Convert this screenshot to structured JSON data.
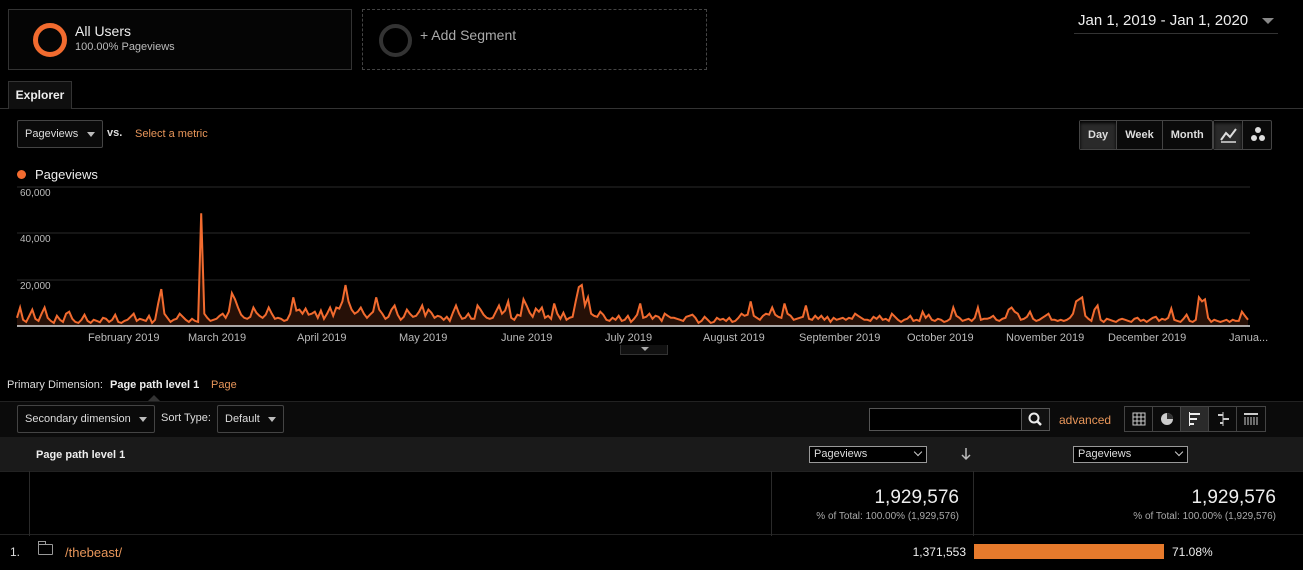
{
  "segments": {
    "active": {
      "title": "All Users",
      "subtitle": "100.00% Pageviews"
    },
    "add_label": "+ Add Segment"
  },
  "date_range": "Jan 1, 2019 - Jan 1, 2020",
  "tabs": {
    "explorer": "Explorer"
  },
  "controls": {
    "metric_select": "Pageviews",
    "vs": "vs.",
    "select_metric": "Select a metric",
    "granularity": [
      "Day",
      "Week",
      "Month"
    ],
    "granularity_selected": "Day"
  },
  "chart_data": {
    "type": "line",
    "series": [
      {
        "name": "Pageviews",
        "color": "#f26b2f",
        "values": [
          4000,
          9000,
          3000,
          2000,
          5000,
          8000,
          3500,
          2500,
          6000,
          9000,
          4000,
          2500,
          1500,
          5000,
          3000,
          2000,
          6000,
          7000,
          3500,
          2000,
          1500,
          3000,
          5500,
          2500,
          1500,
          3000,
          2500,
          1800,
          4000,
          3500,
          2000,
          3000,
          5500,
          2000,
          1500,
          2500,
          3000,
          4500,
          6000,
          2500,
          3500,
          3000,
          2500,
          5000,
          1500,
          3000,
          11000,
          18000,
          6000,
          4000,
          2000,
          3000,
          3500,
          6000,
          4500,
          3000,
          2000,
          3500,
          2500,
          2000,
          55000,
          6000,
          4000,
          2500,
          3000,
          3500,
          5000,
          6000,
          4000,
          7000,
          16000,
          13000,
          9000,
          5500,
          4000,
          3500,
          4500,
          9000,
          6500,
          5000,
          4000,
          5500,
          9000,
          6000,
          3500,
          4000,
          3500,
          2500,
          3000,
          6000,
          14000,
          7500,
          8000,
          6000,
          8500,
          5500,
          6000,
          7000,
          4000,
          7500,
          3500,
          6000,
          9000,
          5000,
          9000,
          8500,
          12000,
          20000,
          12000,
          8000,
          6000,
          7000,
          9000,
          6000,
          4000,
          5500,
          7000,
          14000,
          8000,
          6000,
          3500,
          4500,
          8000,
          10000,
          5500,
          3000,
          4500,
          8000,
          6000,
          4500,
          5000,
          7000,
          10000,
          5000,
          8000,
          6500,
          4000,
          5000,
          4500,
          3000,
          4500,
          2500,
          6500,
          10000,
          6000,
          3500,
          4000,
          6000,
          3500,
          3500,
          10000,
          8000,
          5500,
          4000,
          3500,
          4000,
          7000,
          10000,
          6000,
          7500,
          12000,
          4000,
          3000,
          5500,
          5000,
          13000,
          10000,
          6500,
          4500,
          8500,
          7000,
          9000,
          4000,
          5000,
          3500,
          11000,
          6000,
          3500,
          6500,
          3000,
          4000,
          4500,
          12000,
          19000,
          20000,
          10000,
          14000,
          6000,
          5000,
          4500,
          7000,
          5500,
          3000,
          2500,
          4000,
          3000,
          5000,
          2500,
          3000,
          5000,
          2000,
          3500,
          5500,
          11000,
          4000,
          4500,
          6000,
          3500,
          5000,
          4500,
          2500,
          6000,
          5000,
          4000,
          4000,
          3500,
          3000,
          2500,
          4500,
          5000,
          5500,
          4000,
          1500,
          2500,
          4500,
          3000,
          1500,
          2000,
          4000,
          3000,
          3500,
          2500,
          4000,
          2000,
          2500,
          4000,
          6000,
          5000,
          5500,
          12000,
          5000,
          4000,
          3000,
          5000,
          6000,
          5500,
          9000,
          5500,
          4500,
          4000,
          11000,
          6000,
          5000,
          3000,
          3500,
          4000,
          4500,
          10000,
          3500,
          3000,
          5000,
          3500,
          5000,
          3000,
          4500,
          2000,
          4000,
          3000,
          3500,
          4000,
          3000,
          4000,
          3500,
          6000,
          5000,
          4000,
          3000,
          3000,
          2500,
          4500,
          3500,
          5000,
          3000,
          3500,
          2500,
          6000,
          4500,
          3000,
          2000,
          3000,
          3500,
          5000,
          2500,
          3000,
          2500,
          7000,
          4000,
          5500,
          3000,
          2500,
          3500,
          3000,
          2000,
          2500,
          3500,
          9000,
          5000,
          4000,
          2500,
          3000,
          3500,
          2500,
          4000,
          9000,
          3000,
          3500,
          3500,
          4000,
          5000,
          3000,
          2500,
          3500,
          4000,
          8000,
          9000,
          7000,
          6000,
          3000,
          3500,
          4500,
          7000,
          3500,
          2500,
          3000,
          4000,
          5000,
          6000,
          3000,
          3000,
          2500,
          3000,
          2500,
          3000,
          4000,
          6000,
          12000,
          13000,
          14000,
          5000,
          3500,
          2500,
          8000,
          10000,
          3000,
          2000,
          3500,
          3000,
          2500,
          2000,
          3000,
          3500,
          3000,
          2500,
          2000,
          3500,
          4000,
          2500,
          3000,
          2000,
          3000,
          4000,
          4500,
          2500,
          3500,
          3000,
          4000,
          8500,
          3000,
          2500,
          2000,
          3500,
          5500,
          2500,
          2000,
          3000,
          14000,
          12000,
          13000,
          4000,
          2000,
          3000,
          2500,
          2000,
          2500,
          3000,
          2000,
          3000,
          2500,
          2500,
          7000,
          5000,
          3000
        ]
      }
    ],
    "y_ticks": [
      "60,000",
      "40,000",
      "20,000"
    ],
    "ylim": [
      0,
      60000
    ],
    "x_ticks": [
      "February 2019",
      "March 2019",
      "April 2019",
      "May 2019",
      "June 2019",
      "July 2019",
      "August 2019",
      "September 2019",
      "October 2019",
      "November 2019",
      "December 2019",
      "Janua..."
    ],
    "grid": true,
    "legend": "top-left"
  },
  "primary_dimension": {
    "label": "Primary Dimension:",
    "active": "Page path level 1",
    "alt": "Page"
  },
  "toolbar": {
    "secondary_dimension": "Secondary dimension",
    "sort_type_label": "Sort Type:",
    "sort_type_value": "Default",
    "advanced": "advanced"
  },
  "table": {
    "header": {
      "dimension": "Page path level 1",
      "metric1": "Pageviews",
      "metric2": "Pageviews"
    },
    "totals": {
      "metric1": "1,929,576",
      "metric1_sub": "% of Total: 100.00% (1,929,576)",
      "metric2": "1,929,576",
      "metric2_sub": "% of Total: 100.00% (1,929,576)"
    },
    "rows": [
      {
        "num": "1.",
        "path": "/thebeast/",
        "value": "1,371,553",
        "pct": "71.08%",
        "pct_value": 71.08
      }
    ]
  },
  "colors": {
    "accent": "#f26b2f",
    "link": "#e8965a",
    "bar": "#e67a2c"
  }
}
